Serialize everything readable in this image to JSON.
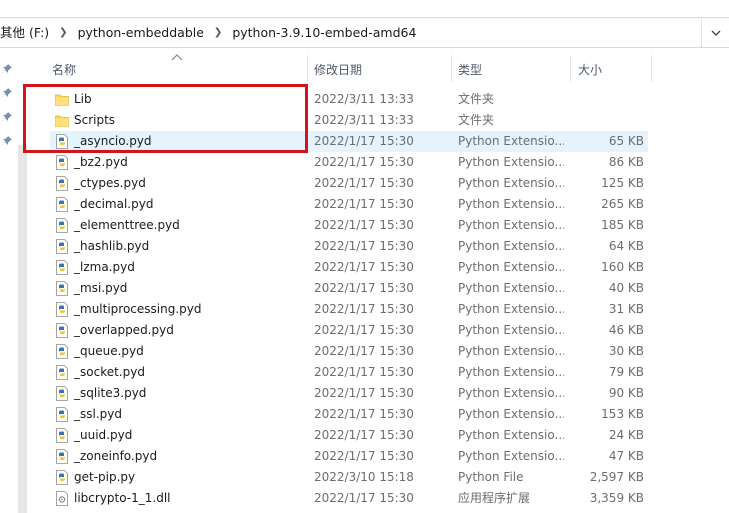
{
  "address": {
    "crumbs": [
      "其他 (F:)",
      "python-embeddable",
      "python-3.9.10-embed-amd64"
    ]
  },
  "columns": {
    "name": "名称",
    "date": "修改日期",
    "type": "类型",
    "size": "大小"
  },
  "rows": [
    {
      "name": "Lib",
      "date": "2022/3/11 13:33",
      "type": "文件夹",
      "size": "",
      "icon": "folder-icon"
    },
    {
      "name": "Scripts",
      "date": "2022/3/11 13:33",
      "type": "文件夹",
      "size": "",
      "icon": "folder-icon"
    },
    {
      "name": "_asyncio.pyd",
      "date": "2022/1/17 15:30",
      "type": "Python Extensio...",
      "size": "65 KB",
      "icon": "python-file-icon",
      "selected": true
    },
    {
      "name": "_bz2.pyd",
      "date": "2022/1/17 15:30",
      "type": "Python Extensio...",
      "size": "86 KB",
      "icon": "python-file-icon"
    },
    {
      "name": "_ctypes.pyd",
      "date": "2022/1/17 15:30",
      "type": "Python Extensio...",
      "size": "125 KB",
      "icon": "python-file-icon"
    },
    {
      "name": "_decimal.pyd",
      "date": "2022/1/17 15:30",
      "type": "Python Extensio...",
      "size": "265 KB",
      "icon": "python-file-icon"
    },
    {
      "name": "_elementtree.pyd",
      "date": "2022/1/17 15:30",
      "type": "Python Extensio...",
      "size": "185 KB",
      "icon": "python-file-icon"
    },
    {
      "name": "_hashlib.pyd",
      "date": "2022/1/17 15:30",
      "type": "Python Extensio...",
      "size": "64 KB",
      "icon": "python-file-icon"
    },
    {
      "name": "_lzma.pyd",
      "date": "2022/1/17 15:30",
      "type": "Python Extensio...",
      "size": "160 KB",
      "icon": "python-file-icon"
    },
    {
      "name": "_msi.pyd",
      "date": "2022/1/17 15:30",
      "type": "Python Extensio...",
      "size": "40 KB",
      "icon": "python-file-icon"
    },
    {
      "name": "_multiprocessing.pyd",
      "date": "2022/1/17 15:30",
      "type": "Python Extensio...",
      "size": "31 KB",
      "icon": "python-file-icon"
    },
    {
      "name": "_overlapped.pyd",
      "date": "2022/1/17 15:30",
      "type": "Python Extensio...",
      "size": "46 KB",
      "icon": "python-file-icon"
    },
    {
      "name": "_queue.pyd",
      "date": "2022/1/17 15:30",
      "type": "Python Extensio...",
      "size": "30 KB",
      "icon": "python-file-icon"
    },
    {
      "name": "_socket.pyd",
      "date": "2022/1/17 15:30",
      "type": "Python Extensio...",
      "size": "79 KB",
      "icon": "python-file-icon"
    },
    {
      "name": "_sqlite3.pyd",
      "date": "2022/1/17 15:30",
      "type": "Python Extensio...",
      "size": "90 KB",
      "icon": "python-file-icon"
    },
    {
      "name": "_ssl.pyd",
      "date": "2022/1/17 15:30",
      "type": "Python Extensio...",
      "size": "153 KB",
      "icon": "python-file-icon"
    },
    {
      "name": "_uuid.pyd",
      "date": "2022/1/17 15:30",
      "type": "Python Extensio...",
      "size": "24 KB",
      "icon": "python-file-icon"
    },
    {
      "name": "_zoneinfo.pyd",
      "date": "2022/1/17 15:30",
      "type": "Python Extensio...",
      "size": "47 KB",
      "icon": "python-file-icon"
    },
    {
      "name": "get-pip.py",
      "date": "2022/3/10 15:18",
      "type": "Python File",
      "size": "2,597 KB",
      "icon": "python-script-icon"
    },
    {
      "name": "libcrypto-1_1.dll",
      "date": "2022/1/17 15:30",
      "type": "应用程序扩展",
      "size": "3,359 KB",
      "icon": "dll-file-icon"
    }
  ],
  "colors": {
    "selection": "#e5f3ff",
    "annotation": "#d4141b",
    "folder": "#ffd35c"
  }
}
